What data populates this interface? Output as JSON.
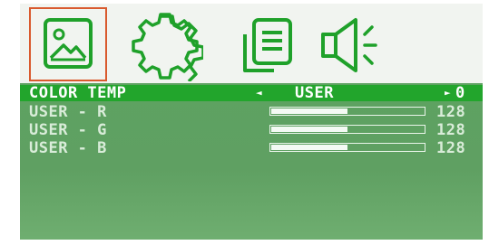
{
  "toolbar": {
    "tabs": [
      {
        "icon": "picture-icon",
        "active": true
      },
      {
        "icon": "gear-icon",
        "active": false
      },
      {
        "icon": "documents-icon",
        "active": false
      },
      {
        "icon": "speaker-icon",
        "active": false
      }
    ],
    "active_color": "#d95a2e",
    "icon_color": "#1fa12a"
  },
  "menu": {
    "selected_row": {
      "label": "COLOR TEMP",
      "left_arrow": "◄",
      "value": "USER",
      "right_arrow": "►",
      "right_value": "0"
    },
    "sliders": [
      {
        "label": "USER - R",
        "value": "128",
        "level": 0.5
      },
      {
        "label": "USER - G",
        "value": "128",
        "level": 0.5
      },
      {
        "label": "USER - B",
        "value": "128",
        "level": 0.5
      }
    ],
    "highlight_color": "#22a52c",
    "panel_color": "#5fa062"
  }
}
